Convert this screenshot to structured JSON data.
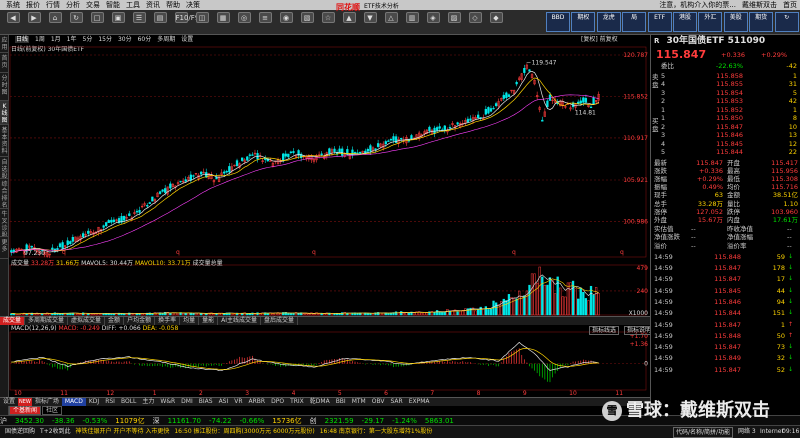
{
  "menu": {
    "items": [
      "系统",
      "报价",
      "行情",
      "分析",
      "交易",
      "智能",
      "工具",
      "资讯",
      "帮助",
      "决策"
    ],
    "right": [
      "注意，机构介入你的票...",
      "戴维斯双击",
      "首页"
    ]
  },
  "toolbar": {
    "logo": "同花顺",
    "app_title": "ETF技术分析",
    "buttons": [
      "◀",
      "▶",
      "⌂",
      "↻",
      "□",
      "▣",
      "☰",
      "▤",
      "F10/F9",
      "◫",
      "▦",
      "◎",
      "≡",
      "◉",
      "▧",
      "☆",
      "▲",
      "▼",
      "△",
      "▥",
      "◈",
      "▨",
      "◇",
      "◆"
    ],
    "right_buttons": [
      "BBD",
      "期权",
      "龙虎",
      "局",
      "ETF",
      "港股",
      "外汇",
      "美股",
      "期货",
      "↻"
    ]
  },
  "side_tabs": [
    "应用",
    "首页",
    "分时图",
    "K线图",
    "基本资料",
    "自选股",
    "综合排名",
    "牛叉诊股",
    "更多"
  ],
  "chart_header": {
    "period_active": "日线",
    "periods": [
      "1周",
      "1月",
      "1年",
      "5分",
      "15分",
      "30分",
      "60分",
      "多周期",
      "设置"
    ],
    "title": "日线(前复权) 30年国债ETF",
    "ratio_label": "[复权] 前复权"
  },
  "price_axis": {
    "labels": [
      "120.787",
      "115.852",
      "110.917",
      "105.921",
      "100.986"
    ],
    "max_label": "119.547",
    "min_label": "97.230",
    "last_label": "114.81"
  },
  "volume": {
    "legend_prefix": "成交量",
    "legend_val1": "33.28万",
    "legend_val2": "31.66万",
    "legend_ma5": "MAVOL5: 30.44万",
    "legend_ma10": "MAVOL10: 33.71万",
    "legend_suffix": "成交量总量",
    "axis_top": "479",
    "axis_mid": "240",
    "axis_unit": "X1000"
  },
  "volume_tabs": [
    "成交量",
    "多周期成交量",
    "虚拟成交量",
    "金额",
    "户均金额",
    "换手率",
    "均量",
    "量能",
    "AI主线成交量",
    "盘后成交量"
  ],
  "macd": {
    "legend": "MACD(12,26,9)",
    "macd_val": "MACD: -0.249",
    "diff_val": "DIFF: +0.066",
    "dea_val": "DEA: -0.058",
    "btn1": "指标线选",
    "btn2": "指标说明",
    "axis_top": "+1.70",
    "axis_top2": "+1.36",
    "axis_zero": "0"
  },
  "indicator_tabs": {
    "badge": "NEW",
    "items": [
      "设置",
      "指标广场",
      "MACD",
      "KDJ",
      "RSI",
      "BOLL",
      "主力",
      "W&R",
      "DMI",
      "BIAS",
      "ASI",
      "VR",
      "ARBR",
      "DPO",
      "TRIX",
      "乾DMA",
      "BBI",
      "MTM",
      "OBV",
      "SAR",
      "EXPMA"
    ],
    "active": "MACD"
  },
  "sub_tabs": [
    "个基新闻",
    "社区"
  ],
  "x_axis_labels": [
    "10",
    "11",
    "12",
    "1",
    "2",
    "3",
    "4",
    "5",
    "6",
    "7",
    "8",
    "9",
    "10",
    "11"
  ],
  "ticker": {
    "items": [
      {
        "text": "沪",
        "color": "#ddd"
      },
      {
        "text": "3452.30",
        "color": "#00e000"
      },
      {
        "text": "-38.36",
        "color": "#00e000"
      },
      {
        "text": "-0.53%",
        "color": "#00e000"
      },
      {
        "text": "11079亿",
        "color": "#ffd400"
      },
      {
        "text": "深",
        "color": "#ddd"
      },
      {
        "text": "11161.70",
        "color": "#00e000"
      },
      {
        "text": "-74.22",
        "color": "#00e000"
      },
      {
        "text": "-0.66%",
        "color": "#00e000"
      },
      {
        "text": "15736亿",
        "color": "#ffd400"
      },
      {
        "text": "创",
        "color": "#ddd"
      },
      {
        "text": "2321.59",
        "color": "#00e000"
      },
      {
        "text": "-29.17",
        "color": "#00e000"
      },
      {
        "text": "-1.24%",
        "color": "#00e000"
      },
      {
        "text": "5863.01",
        "color": "#00e000"
      }
    ]
  },
  "statusbar": {
    "items": [
      {
        "text": "国债逆回购",
        "color": "#ddd"
      },
      {
        "text": "T+2收到此",
        "color": "#ddd"
      },
      {
        "text": "神铁佳银开户 开户不等待 入市更快",
        "color": "#ffd400"
      },
      {
        "text": "16:50 振江股份：周四购(3000万元 6000万元股份)",
        "color": "#ffd400"
      },
      {
        "text": "16:48 南京银行：第一大股东增持1%股份",
        "color": "#ffd400"
      },
      {
        "text": "代码/名称/简拼/功能",
        "color": "#ddd"
      },
      {
        "text": "网络 3",
        "color": "#ddd"
      },
      {
        "text": "Internet",
        "color": "#ddd"
      },
      {
        "text": "09:16",
        "color": "#ddd"
      }
    ]
  },
  "quote": {
    "code_name": "30年国债ETF 511090",
    "side_label": "R",
    "price": "115.847",
    "change": "+0.336",
    "change_pct": "+0.29%",
    "ratio_label": "委比",
    "ratio_val": "-22.63%",
    "ratio_diff": "-42",
    "sell_label": "卖盘",
    "buy_label": "买盘",
    "asks": [
      {
        "lvl": "5",
        "price": "115.858",
        "vol": "1"
      },
      {
        "lvl": "4",
        "price": "115.855",
        "vol": "31"
      },
      {
        "lvl": "3",
        "price": "115.854",
        "vol": "5"
      },
      {
        "lvl": "2",
        "price": "115.853",
        "vol": "42"
      },
      {
        "lvl": "1",
        "price": "115.852",
        "vol": "1"
      }
    ],
    "bids": [
      {
        "lvl": "1",
        "price": "115.850",
        "vol": "8"
      },
      {
        "lvl": "2",
        "price": "115.847",
        "vol": "10"
      },
      {
        "lvl": "3",
        "price": "115.846",
        "vol": "13"
      },
      {
        "lvl": "4",
        "price": "115.845",
        "vol": "12"
      },
      {
        "lvl": "5",
        "price": "115.844",
        "vol": "22"
      }
    ],
    "stats": [
      {
        "l1": "最新",
        "v1": "115.847",
        "l2": "开盘",
        "v2": "115.417"
      },
      {
        "l1": "涨跌",
        "v1": "+0.336",
        "l2": "最高",
        "v2": "115.956"
      },
      {
        "l1": "涨幅",
        "v1": "+0.29%",
        "l2": "最低",
        "v2": "115.308"
      },
      {
        "l1": "振幅",
        "v1": "0.49%",
        "l2": "均价",
        "v2": "115.716"
      },
      {
        "l1": "现手",
        "v1": "63",
        "l2": "金额",
        "v2": "38.51亿"
      },
      {
        "l1": "总手",
        "v1": "33.28万",
        "l2": "量比",
        "v2": "1.10"
      },
      {
        "l1": "涨停",
        "v1": "127.052",
        "l2": "跌停",
        "v2": "103.960"
      },
      {
        "l1": "外盘",
        "v1": "15.67万",
        "l2": "内盘",
        "v2": "17.61万"
      }
    ],
    "nav": [
      {
        "l1": "实估值",
        "v1": "--",
        "l2": "昨收净值",
        "v2": "--"
      },
      {
        "l1": "净值涨跌",
        "v1": "--",
        "l2": "净值涨幅",
        "v2": "--"
      },
      {
        "l1": "溢价",
        "v1": "--",
        "l2": "溢价率",
        "v2": "--"
      }
    ],
    "ticks": [
      {
        "time": "14:59",
        "price": "115.848",
        "vol": "59",
        "dir": "↓",
        "c": "grn"
      },
      {
        "time": "14:59",
        "price": "115.847",
        "vol": "178",
        "dir": "↓",
        "c": "grn"
      },
      {
        "time": "14:59",
        "price": "115.847",
        "vol": "17",
        "dir": "↓",
        "c": "grn"
      },
      {
        "time": "14:59",
        "price": "115.845",
        "vol": "44",
        "dir": "↓",
        "c": "grn"
      },
      {
        "time": "14:59",
        "price": "115.846",
        "vol": "94",
        "dir": "↓",
        "c": "grn"
      },
      {
        "time": "14:59",
        "price": "115.844",
        "vol": "151",
        "dir": "↓",
        "c": "grn"
      },
      {
        "time": "14:59",
        "price": "115.847",
        "vol": "1",
        "dir": "↑",
        "c": "red"
      },
      {
        "time": "14:59",
        "price": "115.848",
        "vol": "50",
        "dir": "↑",
        "c": "red"
      },
      {
        "time": "14:59",
        "price": "115.847",
        "vol": "73",
        "dir": "↓",
        "c": "grn"
      },
      {
        "time": "14:59",
        "price": "115.849",
        "vol": "32",
        "dir": "↓",
        "c": "grn"
      },
      {
        "time": "14:59",
        "price": "115.847",
        "vol": "52",
        "dir": "↓",
        "c": "grn"
      }
    ]
  },
  "watermark": {
    "logo": "雪",
    "text": "雪球：戴维斯双击"
  },
  "colors": {
    "up": "#ff3c3c",
    "down": "#00e8e8",
    "grid": "#7a1010",
    "ma_white": "#e8e8e8",
    "ma_yellow": "#ffd400"
  },
  "chart_data": {
    "type": "candlestick",
    "price_range": [
      97.0,
      121.5
    ],
    "series_anchors": [
      [
        0,
        97.4
      ],
      [
        8,
        97.8
      ],
      [
        15,
        97.3
      ],
      [
        22,
        98.4
      ],
      [
        30,
        99.6
      ],
      [
        38,
        100.6
      ],
      [
        46,
        101.4
      ],
      [
        52,
        102.8
      ],
      [
        58,
        104.3
      ],
      [
        66,
        105.6
      ],
      [
        74,
        106.8
      ],
      [
        80,
        106.0
      ],
      [
        88,
        107.8
      ],
      [
        95,
        108.8
      ],
      [
        102,
        108.0
      ],
      [
        110,
        109.0
      ],
      [
        118,
        108.6
      ],
      [
        126,
        109.3
      ],
      [
        134,
        108.9
      ],
      [
        140,
        109.6
      ],
      [
        148,
        110.5
      ],
      [
        156,
        110.9
      ],
      [
        162,
        111.6
      ],
      [
        170,
        112.1
      ],
      [
        176,
        112.8
      ],
      [
        184,
        113.6
      ],
      [
        190,
        115.2
      ],
      [
        196,
        116.6
      ],
      [
        201,
        119.5
      ],
      [
        204,
        117.8
      ],
      [
        207,
        113.2
      ],
      [
        210,
        115.6
      ],
      [
        214,
        115.2
      ],
      [
        218,
        114.6
      ],
      [
        222,
        115.4
      ],
      [
        226,
        114.8
      ],
      [
        229,
        115.8
      ]
    ],
    "volume_range": [
      0,
      479
    ],
    "volume_anchors": [
      [
        0,
        12
      ],
      [
        20,
        18
      ],
      [
        40,
        14
      ],
      [
        60,
        20
      ],
      [
        80,
        16
      ],
      [
        100,
        20
      ],
      [
        120,
        18
      ],
      [
        140,
        22
      ],
      [
        160,
        28
      ],
      [
        180,
        60
      ],
      [
        192,
        120
      ],
      [
        198,
        220
      ],
      [
        202,
        400
      ],
      [
        206,
        479
      ],
      [
        210,
        300
      ],
      [
        215,
        260
      ],
      [
        220,
        240
      ],
      [
        225,
        230
      ],
      [
        229,
        220
      ]
    ],
    "macd_range": [
      -1.4,
      1.7
    ],
    "macd_anchors": [
      [
        0,
        0.1
      ],
      [
        12,
        0.35
      ],
      [
        22,
        -0.15
      ],
      [
        34,
        0.25
      ],
      [
        46,
        0.38
      ],
      [
        58,
        0.1
      ],
      [
        70,
        -0.25
      ],
      [
        82,
        -0.4
      ],
      [
        94,
        0.25
      ],
      [
        106,
        -0.05
      ],
      [
        118,
        -0.2
      ],
      [
        130,
        0.3
      ],
      [
        142,
        0.2
      ],
      [
        154,
        -0.05
      ],
      [
        166,
        0.2
      ],
      [
        178,
        0.35
      ],
      [
        190,
        0.15
      ],
      [
        198,
        1.2
      ],
      [
        204,
        0.6
      ],
      [
        210,
        -0.4
      ],
      [
        218,
        -0.15
      ],
      [
        224,
        0.1
      ],
      [
        229,
        0.05
      ]
    ]
  }
}
